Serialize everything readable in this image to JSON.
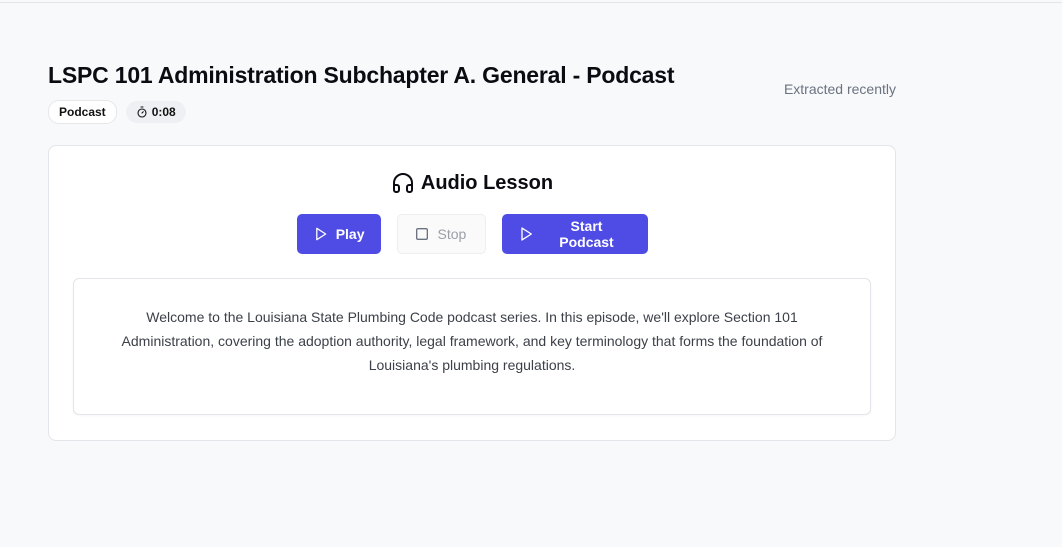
{
  "header": {
    "title": "LSPC 101 Administration Subchapter A. General - Podcast",
    "extracted": "Extracted recently",
    "badges": {
      "type": "Podcast",
      "duration": "0:08"
    }
  },
  "lesson": {
    "heading": "Audio Lesson",
    "heading_icon": "headphones-icon",
    "controls": {
      "play": "Play",
      "stop": "Stop",
      "start": "Start Podcast"
    },
    "transcript": "Welcome to the Louisiana State Plumbing Code podcast series. In this episode, we'll explore Section 101 Administration, covering the adoption authority, legal framework, and key terminology that forms the foundation of Louisiana's plumbing regulations."
  },
  "colors": {
    "primary": "#4f4ce5",
    "background": "#f8f9fb",
    "muted_text": "#6b7280"
  }
}
